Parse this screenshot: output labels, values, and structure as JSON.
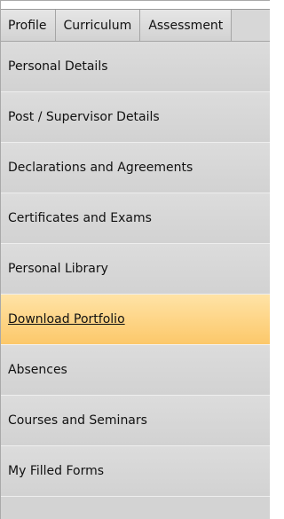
{
  "tabs": [
    {
      "label": "Profile"
    },
    {
      "label": "Curriculum"
    },
    {
      "label": "Assessment"
    }
  ],
  "menu": {
    "active_index": 5,
    "items": [
      {
        "label": "Personal Details"
      },
      {
        "label": "Post / Supervisor Details"
      },
      {
        "label": "Declarations and Agreements"
      },
      {
        "label": "Certificates and Exams"
      },
      {
        "label": "Personal Library"
      },
      {
        "label": "Download Portfolio"
      },
      {
        "label": "Absences"
      },
      {
        "label": "Courses and Seminars"
      },
      {
        "label": "My Filled Forms"
      }
    ]
  },
  "colors": {
    "panel": "#d3d3d3",
    "active_start": "#ffe3a6",
    "active_end": "#fcc86a"
  }
}
